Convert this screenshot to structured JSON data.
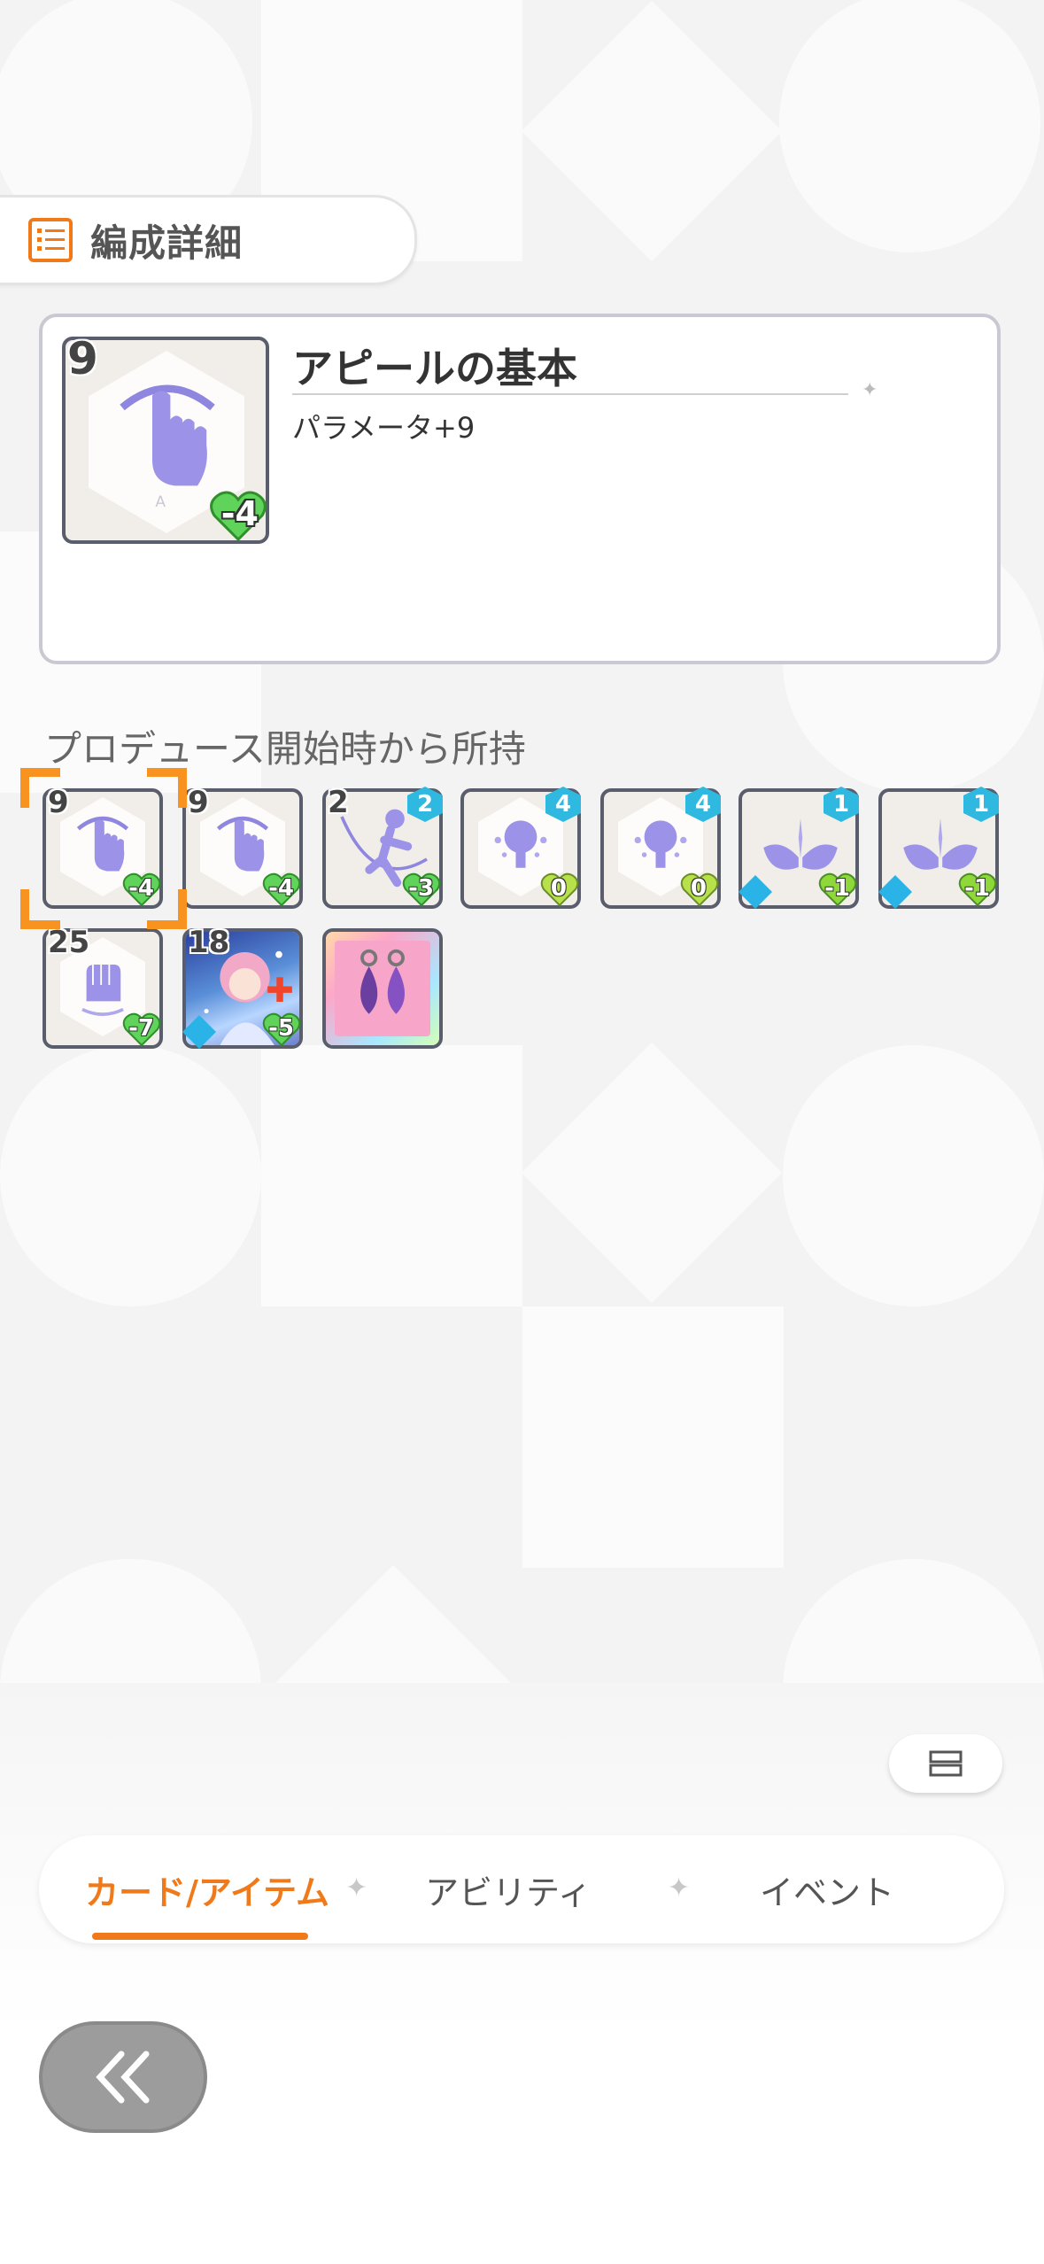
{
  "header": {
    "title": "編成詳細"
  },
  "detail": {
    "card_name": "アピールの基本",
    "description": "パラメータ+9",
    "cost": "9",
    "stamina": "-4"
  },
  "section": {
    "label": "プロデュース開始時から所持"
  },
  "cards": [
    {
      "name": "appeal-basic",
      "cost": "9",
      "stamina": "-4",
      "selected": true
    },
    {
      "name": "appeal-basic",
      "cost": "9",
      "stamina": "-4"
    },
    {
      "name": "dance-card",
      "cost": "2",
      "stamina": "-3",
      "badge": "2"
    },
    {
      "name": "idea-card",
      "stamina": "0",
      "badge": "4"
    },
    {
      "name": "idea-card",
      "stamina": "0",
      "badge": "4"
    },
    {
      "name": "wings-card",
      "stamina": "-1",
      "badge": "1"
    },
    {
      "name": "wings-card",
      "stamina": "-1",
      "badge": "1"
    },
    {
      "name": "fist-card",
      "cost": "25",
      "stamina": "-7"
    },
    {
      "name": "idol-card",
      "cost": "18",
      "stamina": "-5"
    },
    {
      "name": "earring-item"
    }
  ],
  "tabs": {
    "cards_items": "カード/アイテム",
    "ability": "アビリティ",
    "event": "イベント"
  },
  "colors": {
    "accent": "#f07a1a",
    "card_border": "#5a5d6c",
    "badge": "#2fb8e0"
  }
}
